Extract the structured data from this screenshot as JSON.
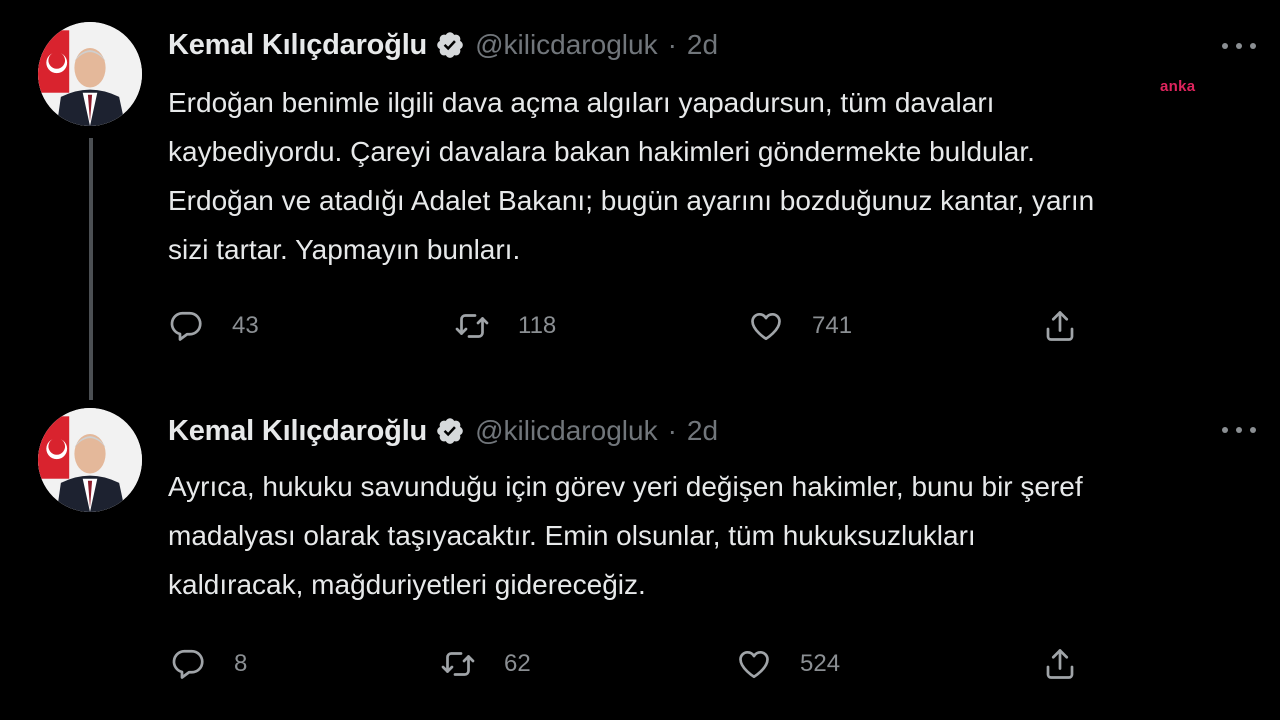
{
  "watermark": "anka",
  "tweets": [
    {
      "author_name": "Kemal Kılıçdaroğlu",
      "handle": "@kilicdarogluk",
      "separator": "·",
      "time": "2d",
      "text": "Erdoğan benimle ilgili dava açma algıları yapadursun, tüm davaları\nkaybediyordu. Çareyi davalara bakan hakimleri göndermekte buldular.\nErdoğan ve atadığı Adalet Bakanı; bugün ayarını bozduğunuz kantar, yarın\nsizi tartar. Yapmayın bunları.",
      "replies": "43",
      "retweets": "118",
      "likes": "741"
    },
    {
      "author_name": "Kemal Kılıçdaroğlu",
      "handle": "@kilicdarogluk",
      "separator": "·",
      "time": "2d",
      "text": "Ayrıca, hukuku savunduğu için görev yeri değişen hakimler, bunu bir şeref\nmadalyası olarak taşıyacaktır. Emin olsunlar, tüm hukuksuzlukları\nkaldıracak, mağduriyetleri gidereceğiz.",
      "replies": "8",
      "retweets": "62",
      "likes": "524"
    }
  ],
  "icons": {
    "verified": "verified-badge-icon",
    "more": "more-options-icon",
    "reply": "reply-icon",
    "retweet": "retweet-icon",
    "like": "like-heart-icon",
    "share": "share-icon"
  },
  "colors": {
    "background": "#000000",
    "text": "#e7e9ea",
    "secondary": "#71767b",
    "watermark": "#e0245e",
    "thread_line": "#4b4f53"
  }
}
